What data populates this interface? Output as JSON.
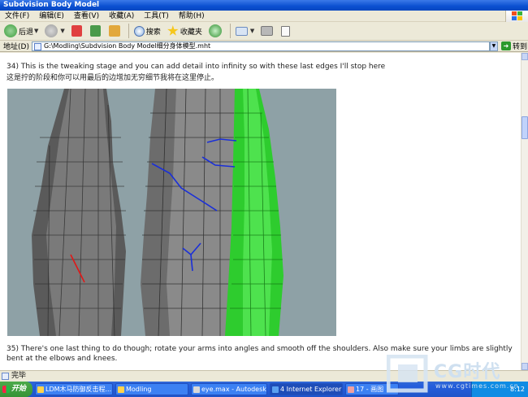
{
  "window": {
    "title": "Subdvision Body Model"
  },
  "menu": [
    "文件(F)",
    "编辑(E)",
    "查看(V)",
    "收藏(A)",
    "工具(T)",
    "帮助(H)"
  ],
  "toolbar": {
    "back_label": "后退",
    "search_label": "搜索",
    "favorites_label": "收藏夹"
  },
  "address": {
    "label": "地址(D)",
    "value": "G:\\Modling\\Subdvision Body Model细分身体模型.mht",
    "go_label": "转到"
  },
  "content": {
    "step34_en": "34) This is the tweaking stage and you can add detail into infinity so with these last edges I'll stop here",
    "step34_zh": "这是拧的阶段和你可以用最后的边增加无穷细节我将在这里停止。",
    "step35_en": "35) There's one last thing to do though; rotate your arms into angles and smooth off the shoulders. Also make sure your limbs are slightly bent at the elbows and knees."
  },
  "status": {
    "text": "完毕"
  },
  "taskbar": {
    "start_label": "开始",
    "tasks": [
      "LDM木马防御反击程...",
      "Modling",
      "eye.max - Autodesk 3...",
      "4 Internet Explorer",
      "17 - 画图"
    ],
    "clock": "8:12"
  },
  "watermark": {
    "brand": "CG时代",
    "url": "www.cgtimes.com.cn"
  },
  "colors": {
    "xp_blue": "#0a4fd0",
    "model_green": "#2ecc2e",
    "edge_blue": "#1a2fd8",
    "edge_red": "#e01818"
  }
}
